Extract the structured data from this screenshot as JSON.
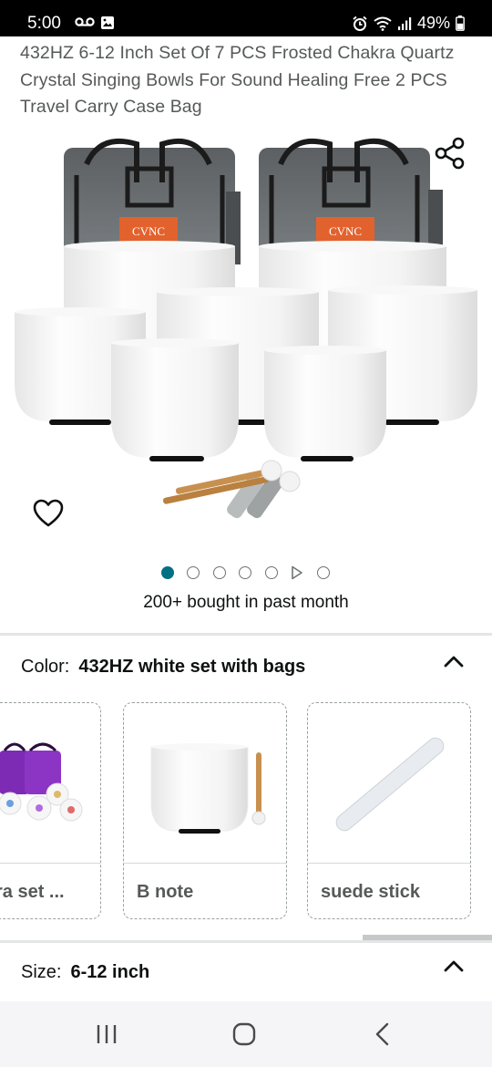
{
  "status_bar": {
    "time": "5:00",
    "battery": "49%",
    "icons": [
      "voicemail-icon",
      "image-icon",
      "alarm-icon",
      "wifi-icon",
      "signal-icon",
      "battery-icon"
    ]
  },
  "product": {
    "title": "432HZ 6-12 Inch Set Of 7 PCS Frosted Chakra Quartz Crystal Singing Bowls For Sound Healing Free 2 PCS Travel Carry Case Bag",
    "brand_text": "CVNC",
    "bought": "200+ bought in past month"
  },
  "carousel": {
    "count": 7,
    "active_index": 0,
    "video_index": 5
  },
  "color": {
    "label": "Color:",
    "value": "432HZ white set with bags",
    "options": [
      {
        "label": "ra set ..."
      },
      {
        "label": "B note"
      },
      {
        "label": "suede stick"
      }
    ]
  },
  "size": {
    "label": "Size:",
    "value": "6-12 inch"
  },
  "colors": {
    "accent": "#007185",
    "text": "#0f1111",
    "muted": "#565959"
  }
}
